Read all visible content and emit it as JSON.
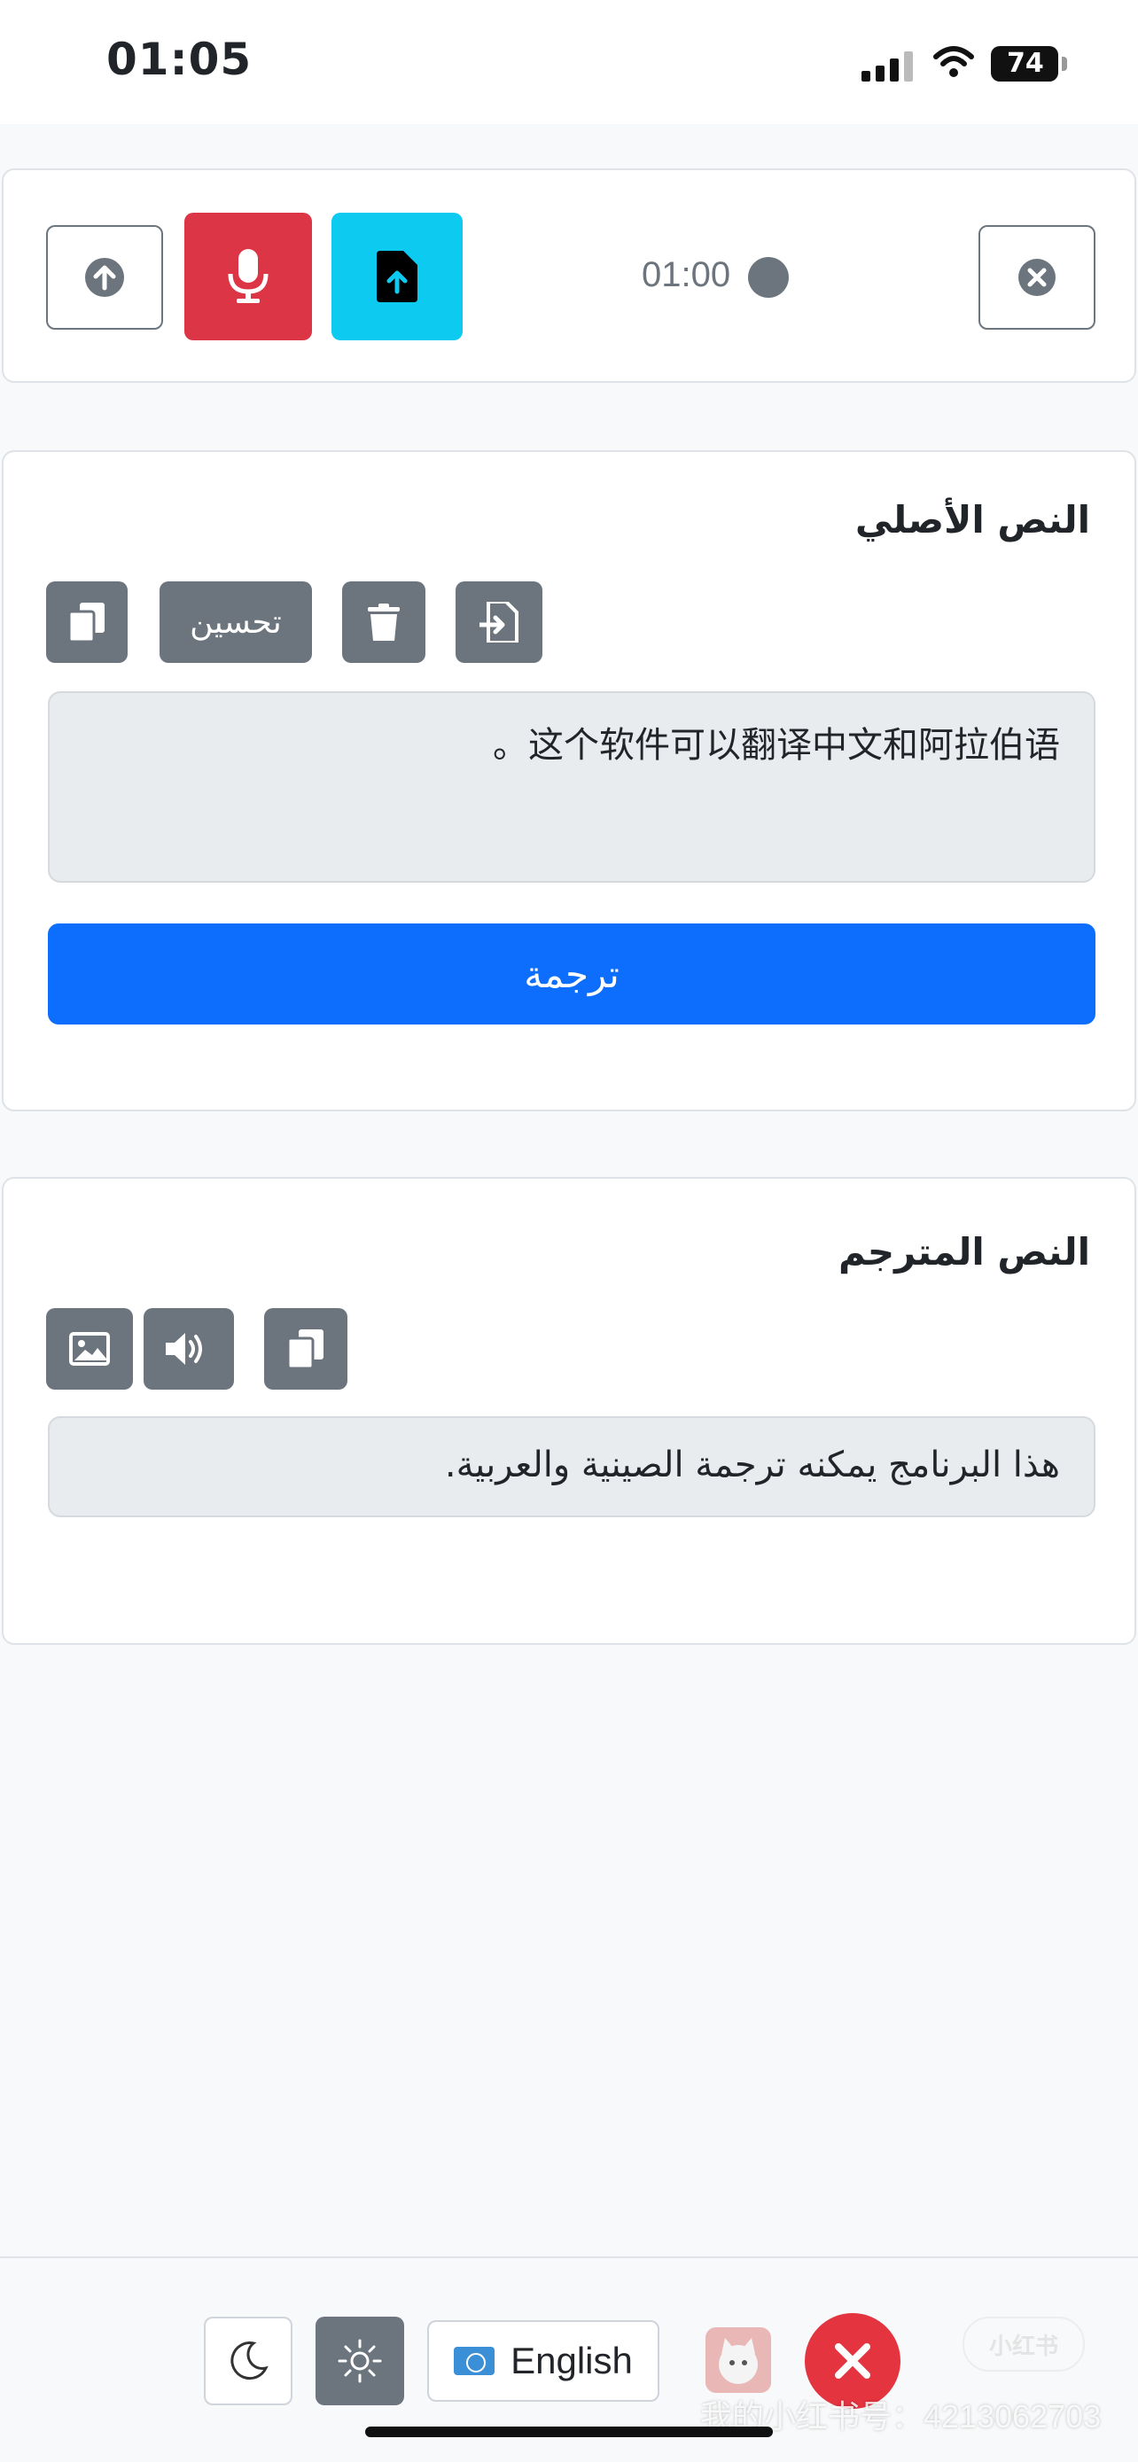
{
  "status_bar": {
    "time": "01:05",
    "battery": "74"
  },
  "recorder": {
    "timer": "01:00"
  },
  "original": {
    "title": "النص الأصلي",
    "improve_label": "تحسين",
    "text": "这个软件可以翻译中文和阿拉伯语。",
    "translate_label": "ترجمة"
  },
  "translated": {
    "title": "النص المترجم",
    "text": "هذا البرنامج يمكنه ترجمة الصينية والعربية."
  },
  "bottom_bar": {
    "language": "English"
  },
  "watermark": {
    "text": "我的小红书号：4213062703",
    "logo": "小红书"
  },
  "colors": {
    "primary": "#0d6efd",
    "danger": "#dc3545",
    "info": "#0dcaf0",
    "secondary": "#6c757d"
  }
}
